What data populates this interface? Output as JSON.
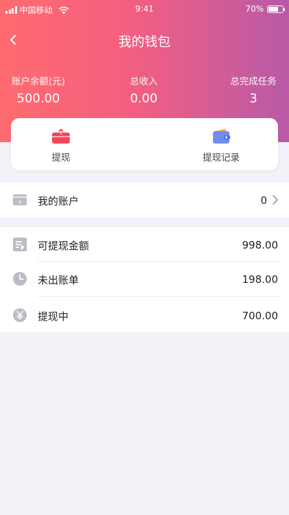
{
  "statusbar": {
    "carrier": "中国移动",
    "time": "9:41",
    "battery": "70%"
  },
  "nav": {
    "title": "我的钱包"
  },
  "stats": [
    {
      "label": "账户余额(元)",
      "value": "500.00"
    },
    {
      "label": "总收入",
      "value": "0.00"
    },
    {
      "label": "总完成任务",
      "value": "3"
    }
  ],
  "actions": [
    {
      "label": "提现",
      "icon": "withdraw-icon"
    },
    {
      "label": "提现记录",
      "icon": "wallet-icon"
    }
  ],
  "account": {
    "label": "我的账户",
    "value": "0"
  },
  "list": [
    {
      "label": "可提现金额",
      "value": "998.00",
      "icon": "withdrawable-icon"
    },
    {
      "label": "未出账单",
      "value": "198.00",
      "icon": "clock-icon"
    },
    {
      "label": "提现中",
      "value": "700.00",
      "icon": "yen-icon"
    }
  ],
  "colors": {
    "gradient_start": "#ff6b6f",
    "gradient_end": "#b85aa8",
    "withdraw_icon": "#f2455b",
    "wallet_icon": "#6f8cf2",
    "row_icon": "#bcbcc4"
  }
}
